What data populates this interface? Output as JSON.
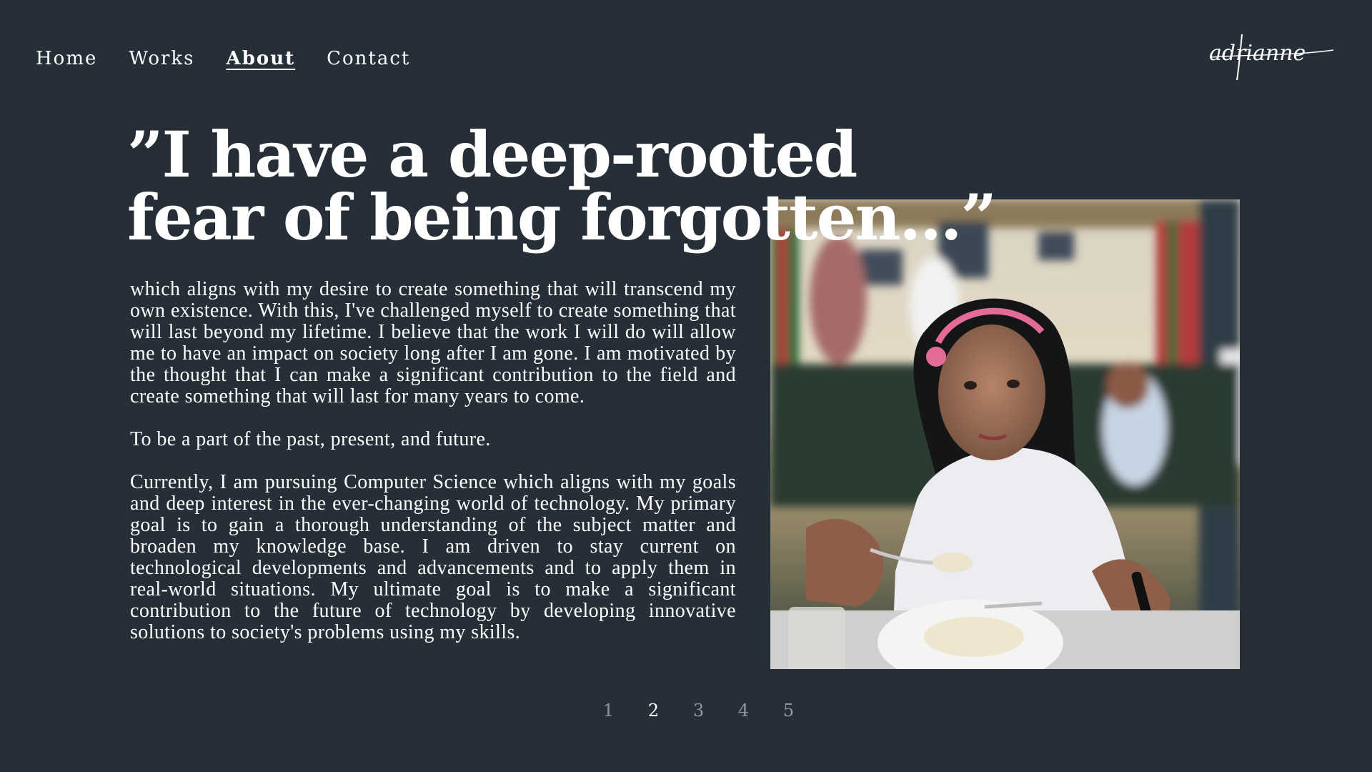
{
  "nav": {
    "items": [
      {
        "label": "Home"
      },
      {
        "label": "Works"
      },
      {
        "label": "About"
      },
      {
        "label": "Contact"
      }
    ],
    "active": "About"
  },
  "logo": {
    "text": "adrianne"
  },
  "headline": {
    "line1": "”I have a deep-rooted",
    "line2": "fear of being forgotten...”"
  },
  "paragraphs": [
    "which aligns with my desire to create something that will transcend my own existence. With this, I've challenged myself to create something that will last beyond my lifetime. I believe that the work I will do will allow me to have an impact on society long after I am gone. I am motivated by the thought that I can make a significant contribution to the field and create something that will last for many years to come.",
    "To be a part of the past, present, and future.",
    "Currently, I am pursuing Computer Science which aligns with my goals and deep interest in the ever-changing world of technology. My primary goal is to gain a thorough understanding of the subject matter and broaden my knowledge base. I am driven to stay current on technological developments and advancements and to apply them in real-world situations. My ultimate goal is to make a significant contribution to the future of technology by developing innovative solutions to society's problems using my skills."
  ],
  "pagination": {
    "pages": [
      "1",
      "2",
      "3",
      "4",
      "5"
    ],
    "current": "2"
  },
  "colors": {
    "background": "#262f37",
    "text": "#ffffff",
    "pager_inactive": "#8f98a0"
  }
}
